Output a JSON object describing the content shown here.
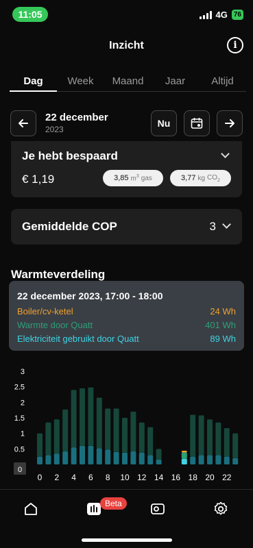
{
  "status": {
    "time": "11:05",
    "network": "4G",
    "battery": "76"
  },
  "header": {
    "title": "Inzicht",
    "info_icon": "i"
  },
  "tabs": [
    {
      "label": "Dag",
      "active": true
    },
    {
      "label": "Week",
      "active": false
    },
    {
      "label": "Maand",
      "active": false
    },
    {
      "label": "Jaar",
      "active": false
    },
    {
      "label": "Altijd",
      "active": false
    }
  ],
  "date_nav": {
    "date": "22 december",
    "year": "2023",
    "today_label": "Nu"
  },
  "savings": {
    "title": "Je hebt bespaard",
    "amount": "€ 1,19",
    "gas_value": "3,85",
    "gas_unit": "gas",
    "co2_value": "3,77",
    "co2_unit": "kg"
  },
  "cop": {
    "title": "Gemiddelde COP",
    "value": "3"
  },
  "distribution": {
    "title": "Warmteverdeling"
  },
  "tooltip": {
    "title": "22 december 2023, 17:00 - 18:00",
    "rows": [
      {
        "label": "Boiler/cv-ketel",
        "value": "24 Wh",
        "color": "#f0a030"
      },
      {
        "label": "Warmte door Quatt",
        "value": "401 Wh",
        "color": "#2e9f78"
      },
      {
        "label": "Elektriciteit gebruikt door Quatt",
        "value": "89 Wh",
        "color": "#3fd3e3"
      }
    ]
  },
  "chart_data": {
    "type": "bar",
    "stacked": true,
    "y_ticks": [
      "3",
      "2.5",
      "2",
      "1.5",
      "1",
      "0.5",
      "0"
    ],
    "x_ticks": [
      "0",
      "2",
      "4",
      "6",
      "8",
      "10",
      "12",
      "14",
      "16",
      "18",
      "20",
      "22"
    ],
    "ylim": [
      0,
      3
    ],
    "x": [
      0,
      1,
      2,
      3,
      4,
      5,
      6,
      7,
      8,
      9,
      10,
      11,
      12,
      13,
      14,
      15,
      16,
      17,
      18,
      19,
      20,
      21,
      22,
      23
    ],
    "series": [
      {
        "values": [
          0.25,
          0.3,
          0.35,
          0.42,
          0.55,
          0.6,
          0.6,
          0.52,
          0.48,
          0.4,
          0.38,
          0.42,
          0.38,
          0.3,
          0.16,
          0,
          0,
          0.18,
          0.25,
          0.3,
          0.3,
          0.3,
          0.25,
          0.2
        ],
        "color": "#1a6f7e"
      },
      {
        "values": [
          0.75,
          1.05,
          1.1,
          1.35,
          1.85,
          1.85,
          1.88,
          1.63,
          1.32,
          1.4,
          1.12,
          1.28,
          0.97,
          0.9,
          0.34,
          0,
          0,
          0.21,
          1.35,
          1.28,
          1.15,
          1.05,
          0.92,
          0.8
        ],
        "color": "#16473a"
      },
      {
        "values": [
          0,
          0,
          0,
          0,
          0,
          0,
          0,
          0,
          0,
          0,
          0,
          0,
          0,
          0,
          0,
          0,
          0,
          0.05,
          0,
          0,
          0,
          0,
          0,
          0
        ],
        "color": "#f0a030"
      }
    ],
    "highlight_index": 17
  },
  "bottom_nav": {
    "items": [
      "home-icon",
      "insights-icon",
      "device-icon",
      "settings-icon"
    ],
    "beta_label": "Beta"
  }
}
